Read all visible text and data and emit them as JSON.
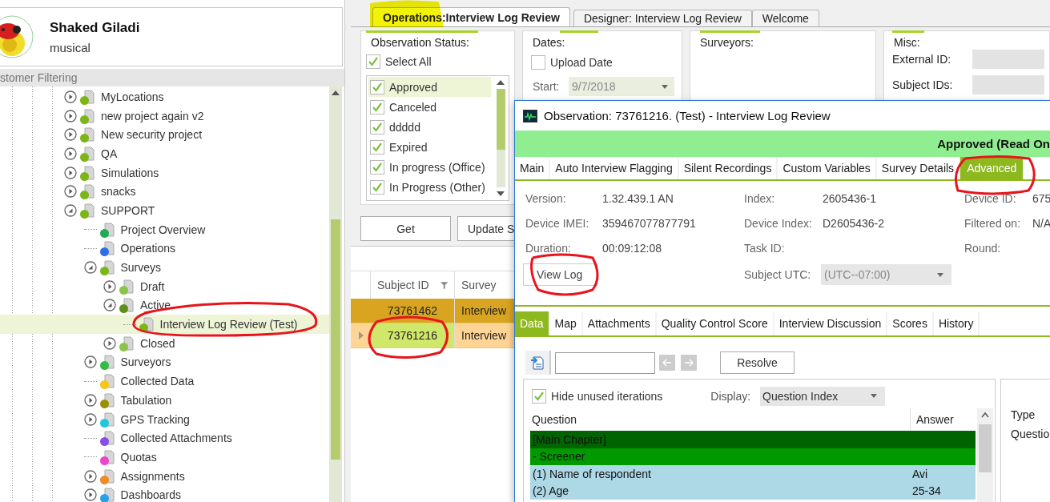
{
  "profile": {
    "name": "Shaked Giladi",
    "subtitle": "musical"
  },
  "filter_bar": {
    "title": "stomer Filtering"
  },
  "tree": [
    {
      "label": "MyLocations",
      "color": "#7cb518",
      "expanded": false,
      "selected": false
    },
    {
      "label": "new project again v2",
      "color": "#7cb518",
      "expanded": false,
      "selected": false
    },
    {
      "label": "New security project",
      "color": "#7cb518",
      "expanded": false,
      "selected": false
    },
    {
      "label": "QA",
      "color": "#7cb518",
      "expanded": false,
      "selected": false
    },
    {
      "label": "Simulations",
      "color": "#7cb518",
      "expanded": false,
      "selected": false
    },
    {
      "label": "snacks",
      "color": "#7cb518",
      "expanded": false,
      "selected": false
    },
    {
      "label": "SUPPORT",
      "color": "#7cb518",
      "expanded": true,
      "selected": false,
      "children": [
        {
          "label": "Project Overview",
          "color": "#22aa55",
          "selected": false
        },
        {
          "label": "Operations",
          "color": "#2f6fdf",
          "selected": false
        },
        {
          "label": "Surveys",
          "color": "#7cb518",
          "expanded": true,
          "selected": false,
          "children": [
            {
              "label": "Draft",
              "color": "#8bc34a",
              "expanded": false,
              "selected": false
            },
            {
              "label": "Active",
              "color": "#5f8f1a",
              "expanded": true,
              "selected": false,
              "children": [
                {
                  "label": "Interview Log Review (Test)",
                  "color": "#7cb518",
                  "selected": true
                }
              ]
            },
            {
              "label": "Closed",
              "color": "#8bc34a",
              "expanded": false,
              "selected": false
            }
          ]
        },
        {
          "label": "Surveyors",
          "color": "#33bb44",
          "expanded": false,
          "selected": false
        },
        {
          "label": "Collected Data",
          "color": "#f5c518",
          "selected": false
        },
        {
          "label": "Tabulation",
          "color": "#9a8f00",
          "expanded": false,
          "selected": false
        },
        {
          "label": "GPS Tracking",
          "color": "#1ec8d8",
          "expanded": false,
          "selected": false
        },
        {
          "label": "Collected Attachments",
          "color": "#8a4ee8",
          "selected": false
        },
        {
          "label": "Quotas",
          "color": "#ee44cc",
          "selected": false
        },
        {
          "label": "Assignments",
          "color": "#f08a24",
          "expanded": false,
          "selected": false
        },
        {
          "label": "Dashboards",
          "color": "#2aa0e8",
          "expanded": false,
          "selected": false
        }
      ]
    }
  ],
  "main_tabs": [
    {
      "label": "Operations:Interview Log Review",
      "selected": true
    },
    {
      "label": "Designer: Interview Log Review",
      "selected": false
    },
    {
      "label": "Welcome",
      "selected": false
    }
  ],
  "observation_status": {
    "title": "Observation Status:",
    "select_all": {
      "label": "Select All",
      "checked": true
    },
    "items": [
      {
        "label": "Approved",
        "checked": true,
        "selected": true
      },
      {
        "label": "Canceled",
        "checked": true,
        "selected": false
      },
      {
        "label": "ddddd",
        "checked": true,
        "selected": false
      },
      {
        "label": "Expired",
        "checked": true,
        "selected": false
      },
      {
        "label": "In progress (Office)",
        "checked": true,
        "selected": false
      },
      {
        "label": "In Progress (Other)",
        "checked": true,
        "selected": false
      }
    ]
  },
  "dates": {
    "title": "Dates:",
    "upload_date": {
      "label": "Upload Date",
      "checked": false
    },
    "start_label": "Start:",
    "start_value": "9/7/2018"
  },
  "surveyors": {
    "title": "Surveyors:"
  },
  "misc": {
    "title": "Misc:",
    "fields": [
      {
        "label": "External ID:"
      },
      {
        "label": "Subject IDs:"
      }
    ]
  },
  "buttons": [
    "Get",
    "Update S"
  ],
  "grid": {
    "columns": [
      "Subject ID",
      "Survey"
    ],
    "rows": [
      {
        "subject_id": "73761462",
        "survey": "Interview",
        "selected": false
      },
      {
        "subject_id": "73761216",
        "survey": "Interview",
        "selected": true
      }
    ]
  },
  "dialog": {
    "title": "Observation: 73761216. (Test) - Interview Log Review",
    "status": "Approved (Read On",
    "tabs": [
      {
        "label": "Main",
        "selected": false
      },
      {
        "label": "Auto Interview Flagging",
        "selected": false
      },
      {
        "label": "Silent Recordings",
        "selected": false
      },
      {
        "label": "Custom Variables",
        "selected": false
      },
      {
        "label": "Survey Details",
        "selected": false
      },
      {
        "label": "Advanced",
        "selected": true
      }
    ],
    "fields": [
      {
        "label": "Version:",
        "value": "1.32.439.1 AN"
      },
      {
        "label": "Index:",
        "value": "2605436-1"
      },
      {
        "label": "Device ID:",
        "value": "675"
      },
      {
        "label": "Device IMEI:",
        "value": "359467077877791"
      },
      {
        "label": "Device Index:",
        "value": "D2605436-2"
      },
      {
        "label": "Filtered on:",
        "value": "N/A"
      },
      {
        "label": "Duration:",
        "value": "00:09:12:08"
      },
      {
        "label": "Task ID:"
      },
      {
        "label": "Round:"
      }
    ],
    "view_log": "View Log",
    "subject_utc": {
      "label": "Subject UTC:",
      "value": "(UTC--07:00)"
    },
    "data_tabs": [
      {
        "label": "Data",
        "selected": true
      },
      {
        "label": "Map",
        "selected": false
      },
      {
        "label": "Attachments",
        "selected": false
      },
      {
        "label": "Quality Control Score",
        "selected": false
      },
      {
        "label": "Interview Discussion",
        "selected": false
      },
      {
        "label": "Scores",
        "selected": false
      },
      {
        "label": "History",
        "selected": false
      }
    ],
    "resolve": "Resolve",
    "hide_unused": {
      "label": "Hide unused iterations",
      "checked": true
    },
    "display": {
      "label": "Display:",
      "value": "Question Index"
    },
    "table": {
      "columns": [
        "Question",
        "Answer"
      ],
      "rows": [
        {
          "kind": "chapter",
          "question": "[Main Chapter]"
        },
        {
          "kind": "section",
          "question": "- Screener"
        },
        {
          "kind": "question",
          "question": "(1) Name of respondent",
          "answer": "Avi"
        },
        {
          "kind": "question",
          "question": "(2) Age",
          "answer": "25-34"
        }
      ]
    },
    "side": [
      "Type",
      "Questio"
    ]
  }
}
